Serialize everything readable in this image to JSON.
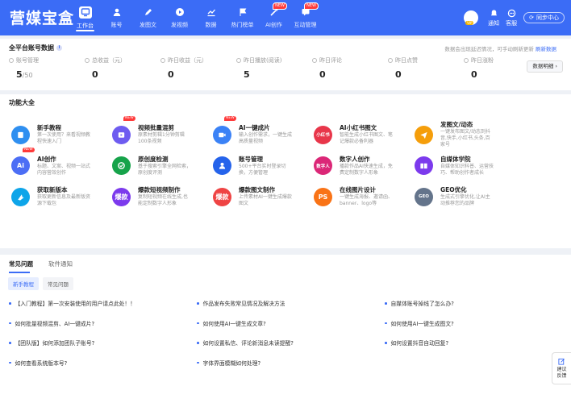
{
  "app": {
    "logo": "营媒宝盒"
  },
  "nav": {
    "items": [
      {
        "label": "工作台",
        "icon": "monitor-icon",
        "active": true,
        "badge": ""
      },
      {
        "label": "账号",
        "icon": "user-icon",
        "active": false,
        "badge": ""
      },
      {
        "label": "发图文",
        "icon": "pen-icon",
        "active": false,
        "badge": ""
      },
      {
        "label": "发视频",
        "icon": "play-icon",
        "active": false,
        "badge": ""
      },
      {
        "label": "数据",
        "icon": "chart-icon",
        "active": false,
        "badge": ""
      },
      {
        "label": "热门榜单",
        "icon": "flag-icon",
        "active": false,
        "badge": ""
      },
      {
        "label": "AI创作",
        "icon": "wand-icon",
        "active": false,
        "badge": "NEW"
      },
      {
        "label": "互动管理",
        "icon": "chat-icon",
        "active": false,
        "badge": "NEW"
      }
    ]
  },
  "topright": {
    "notify": "通知",
    "service": "客服",
    "sync": "同步中心"
  },
  "stats": {
    "title": "全平台账号数据",
    "note": "数据会出现延迟情况，可手动刷新更新",
    "refresh": "刷新数据",
    "detail_button": "数据明细 ›",
    "items": [
      {
        "label": "账号管理",
        "value": "5",
        "suffix": "/50"
      },
      {
        "label": "总收益（元）",
        "value": "0",
        "suffix": ""
      },
      {
        "label": "昨日收益（元）",
        "value": "0",
        "suffix": ""
      },
      {
        "label": "昨日播放(阅读)",
        "value": "5",
        "suffix": ""
      },
      {
        "label": "昨日评论",
        "value": "0",
        "suffix": ""
      },
      {
        "label": "昨日点赞",
        "value": "0",
        "suffix": ""
      },
      {
        "label": "昨日涨粉",
        "value": "0",
        "suffix": ""
      }
    ]
  },
  "functions": {
    "title": "功能大全",
    "items": [
      {
        "title": "新手教程",
        "desc": "第一次使用？来看视频教程快速入门",
        "icon": "book-icon",
        "color": "#2f8ff0",
        "text": "",
        "badge": ""
      },
      {
        "title": "视频批量混剪",
        "desc": "原素材剪辑1分钟剪辑100条视频",
        "icon": "scissors-video-icon",
        "color": "#6e5cf0",
        "text": "",
        "badge": "NEW"
      },
      {
        "title": "AI一键成片",
        "desc": "输入创作需求，一键生成高质量视频",
        "icon": "video-ai-icon",
        "color": "#3b82f6",
        "text": "",
        "badge": "NEW"
      },
      {
        "title": "AI小红书图文",
        "desc": "智能生成小红书图文、笔记爆款必备利器",
        "icon": "xiaohongshu-icon",
        "color": "#e8364a",
        "text": "小红书",
        "badge": ""
      },
      {
        "title": "发图文/动态",
        "desc": "一键发布图文/动态到抖音,快手,小红书,头条,百家号",
        "icon": "send-icon",
        "color": "#f59e0b",
        "text": "",
        "badge": ""
      },
      {
        "title": "AI创作",
        "desc": "标题、文案、视频一站式内容营效创作",
        "icon": "ai-icon",
        "color": "#4c6ef5",
        "text": "Ai",
        "badge": "NEW"
      },
      {
        "title": "原创度检测",
        "desc": "基于搜索引擎全网检索，原创度评测",
        "icon": "check-circle-icon",
        "color": "#16a34a",
        "text": "",
        "badge": ""
      },
      {
        "title": "账号管理",
        "desc": "500+平台实时登录切换，方便管理",
        "icon": "account-icon",
        "color": "#2563eb",
        "text": "",
        "badge": ""
      },
      {
        "title": "数字人创作",
        "desc": "播款作品AI快速生成，免费定制数字人形象",
        "icon": "digital-human-icon",
        "color": "#db2777",
        "text": "数字人",
        "badge": ""
      },
      {
        "title": "自媒体学院",
        "desc": "自媒体知识科普、运营技巧、帮助创作者成长",
        "icon": "college-icon",
        "color": "#7c3aed",
        "text": "",
        "badge": ""
      },
      {
        "title": "获取新版本",
        "desc": "获取更新信息及最新版资源下载包",
        "icon": "update-icon",
        "color": "#0ea5e9",
        "text": "",
        "badge": ""
      },
      {
        "title": "爆款短视频制作",
        "desc": "复制短视频在线生成,也能定制数字人形象",
        "icon": "viral-video-icon",
        "color": "#7c3aed",
        "text": "爆款",
        "badge": ""
      },
      {
        "title": "爆款图文制作",
        "desc": "上传素材AI一键生成爆款图文",
        "icon": "viral-post-icon",
        "color": "#ef4444",
        "text": "爆款",
        "badge": ""
      },
      {
        "title": "在线图片设计",
        "desc": "一键生成海报、邀请函、banner、logo等",
        "icon": "ps-icon",
        "color": "#f97316",
        "text": "PS",
        "badge": ""
      },
      {
        "title": "GEO优化",
        "desc": "生成式引擎优化,让AI主动推荐您的品牌",
        "icon": "geo-icon",
        "color": "#64748b",
        "text": "GEO",
        "badge": ""
      }
    ]
  },
  "faq": {
    "tabs": [
      "常见问题",
      "软件通知"
    ],
    "subtabs": [
      "新手教程",
      "常见问题"
    ],
    "questions": [
      "【入门教程】第一次安装使用的用户请点此处！！",
      "作品发布失败常见情况及解决方法",
      "自媒体账号掉线了怎么办?",
      "如何批量视频混剪、AI一键成片?",
      "如何使用AI一键生成文章?",
      "如何使用AI一键生成图文?",
      "【团队版】如何添加团队子账号?",
      "如何设置私信、评论新消息未读提醒?",
      "如何设置抖音自动回复?",
      "如何查看系统版本号?",
      "字体界面模糊如何处理?"
    ]
  },
  "feedback": {
    "line1": "建议",
    "line2": "反馈"
  }
}
